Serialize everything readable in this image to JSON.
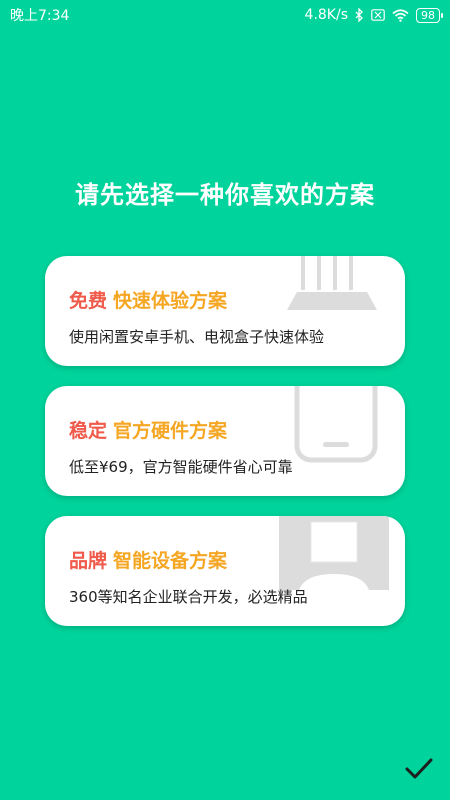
{
  "status_bar": {
    "time": "晚上7:34",
    "network_speed": "4.8K/s",
    "battery": "98",
    "icons": [
      "bluetooth-icon",
      "sim-disabled-icon",
      "wifi-icon",
      "battery-icon"
    ]
  },
  "headline": "请先选择一种你喜欢的方案",
  "cards": [
    {
      "title_primary": "免费",
      "title_secondary": "快速体验方案",
      "description": "使用闲置安卓手机、电视盒子快速体验",
      "illustration": "router-icon"
    },
    {
      "title_primary": "稳定",
      "title_secondary": "官方硬件方案",
      "description": "低至¥69，官方智能硬件省心可靠",
      "illustration": "phone-icon"
    },
    {
      "title_primary": "品牌",
      "title_secondary": "智能设备方案",
      "description": "360等知名企业联合开发，必选精品",
      "illustration": "smart-device-icon"
    }
  ],
  "confirm": {
    "icon": "check-icon"
  },
  "colors": {
    "background": "#00D39B",
    "title_primary": "#F05A4A",
    "title_secondary": "#F5A623",
    "card": "#FFFFFF",
    "illustration": "#DCDCDC"
  }
}
